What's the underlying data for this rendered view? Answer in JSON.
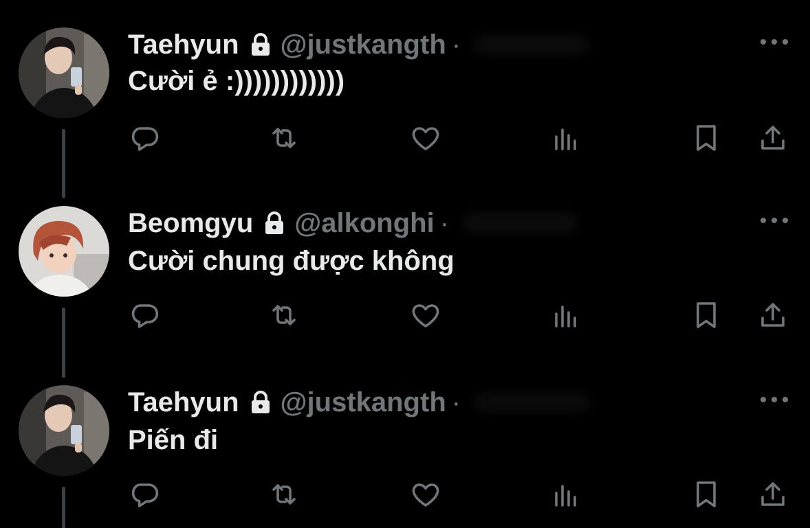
{
  "tweets": [
    {
      "display_name": "Taehyun",
      "handle": "@justkangth",
      "separator": "·",
      "text": "Cười ẻ :))))))))))))",
      "avatar": "avatar-taehyun"
    },
    {
      "display_name": "Beomgyu",
      "handle": "@alkonghi",
      "separator": "·",
      "text": "Cười chung được không",
      "avatar": "avatar-beomgyu"
    },
    {
      "display_name": "Taehyun",
      "handle": "@justkangth",
      "separator": "·",
      "text": "Piến đi",
      "avatar": "avatar-taehyun"
    }
  ],
  "icons": {
    "lock": "lock-icon",
    "more": "more-icon",
    "reply": "reply-icon",
    "retweet": "retweet-icon",
    "like": "heart-icon",
    "views": "views-icon",
    "bookmark": "bookmark-icon",
    "share": "share-icon"
  },
  "colors": {
    "background": "#000000",
    "primary_text": "#e7e9ea",
    "secondary_text": "#71767b",
    "thread_line": "#3e4144"
  }
}
